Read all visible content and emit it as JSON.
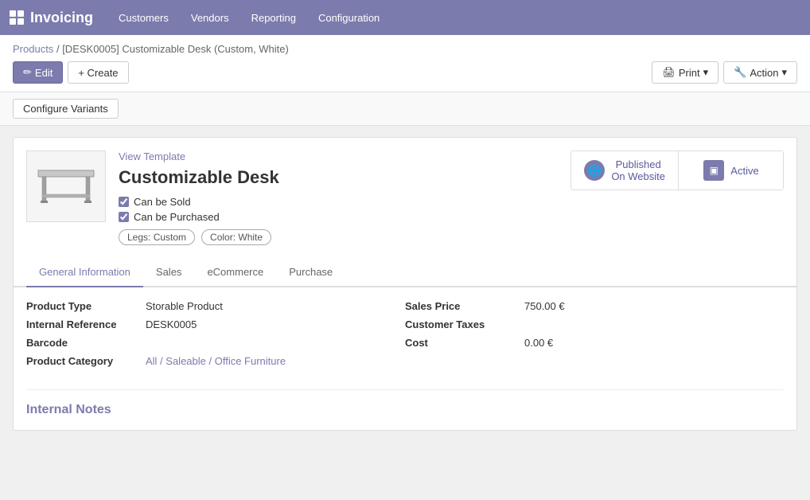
{
  "app": {
    "title": "Invoicing",
    "logo_label": "Invoicing"
  },
  "topnav": {
    "menu": [
      {
        "label": "Customers",
        "id": "customers"
      },
      {
        "label": "Vendors",
        "id": "vendors"
      },
      {
        "label": "Reporting",
        "id": "reporting"
      },
      {
        "label": "Configuration",
        "id": "configuration"
      }
    ]
  },
  "breadcrumb": {
    "parent": "Products",
    "separator": "/",
    "current": "[DESK0005] Customizable Desk (Custom, White)"
  },
  "actions": {
    "edit_label": "Edit",
    "create_label": "+ Create",
    "print_label": "Print",
    "action_label": "Action"
  },
  "config_bar": {
    "button_label": "Configure Variants"
  },
  "product": {
    "view_template_link": "View Template",
    "title": "Customizable Desk",
    "can_be_sold_label": "Can be Sold",
    "can_be_purchased_label": "Can be Purchased",
    "variant_tags": [
      "Legs: Custom",
      "Color: White"
    ],
    "status_published": "Published\nOn Website",
    "status_published_line1": "Published",
    "status_published_line2": "On Website",
    "status_active": "Active"
  },
  "tabs": [
    {
      "label": "General Information",
      "id": "general",
      "active": true
    },
    {
      "label": "Sales",
      "id": "sales"
    },
    {
      "label": "eCommerce",
      "id": "ecommerce"
    },
    {
      "label": "Purchase",
      "id": "purchase"
    }
  ],
  "general_info": {
    "left_fields": [
      {
        "label": "Product Type",
        "value": "Storable Product",
        "is_link": false
      },
      {
        "label": "Internal Reference",
        "value": "DESK0005",
        "is_link": false
      },
      {
        "label": "Barcode",
        "value": "",
        "is_link": false
      },
      {
        "label": "Product Category",
        "value": "All / Saleable / Office Furniture",
        "is_link": true
      }
    ],
    "right_fields": [
      {
        "label": "Sales Price",
        "value": "750.00 €",
        "is_link": false
      },
      {
        "label": "Customer Taxes",
        "value": "",
        "is_link": false
      },
      {
        "label": "Cost",
        "value": "0.00 €",
        "is_link": false
      }
    ]
  },
  "internal_notes": {
    "title": "Internal Notes"
  }
}
